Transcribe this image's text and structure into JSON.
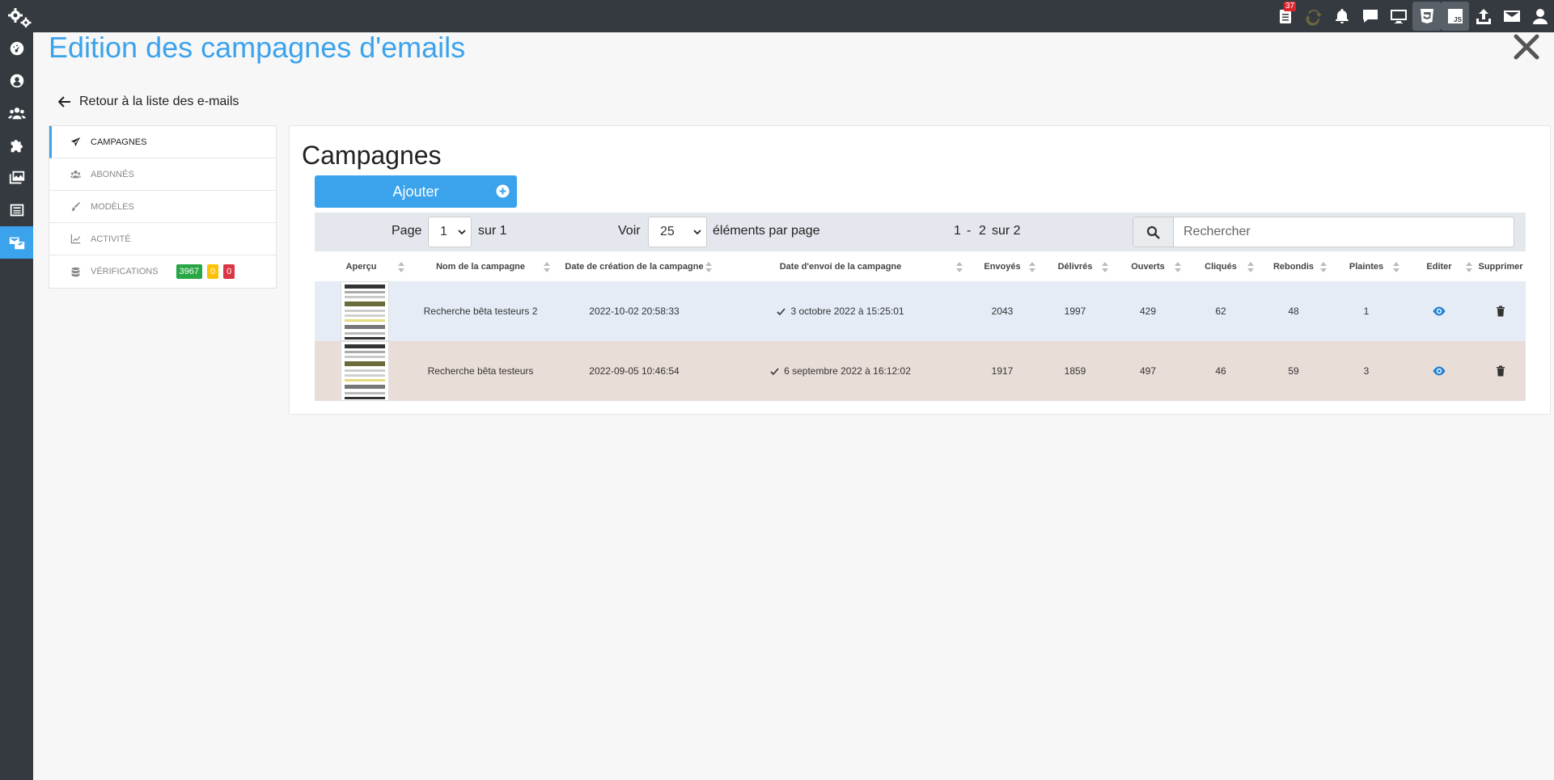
{
  "app": {
    "title": "Edition des campagnes d'emails",
    "back_label": "Retour à la liste des e-mails",
    "notification_count": "37"
  },
  "topbar_icons": [
    "tasks-icon",
    "sync-icon",
    "bell-icon",
    "chat-icon",
    "desktop-icon",
    "css-icon",
    "js-icon",
    "upload-icon",
    "mail-icon",
    "user-icon"
  ],
  "sidebar_icons": [
    "dashboard-icon",
    "user-circle-icon",
    "users-icon",
    "puzzle-icon",
    "images-icon",
    "newspaper-icon",
    "mail-bulk-icon"
  ],
  "menu": {
    "items": [
      {
        "label": "CAMPAGNES",
        "icon": "paper-plane-icon"
      },
      {
        "label": "ABONNÉS",
        "icon": "users-icon"
      },
      {
        "label": "MODÈLES",
        "icon": "brush-icon"
      },
      {
        "label": "ACTIVITÉ",
        "icon": "chart-line-icon"
      },
      {
        "label": "VÉRIFICATIONS",
        "icon": "database-icon"
      }
    ],
    "verif_badges": [
      {
        "value": "3967",
        "color": "#28a745"
      },
      {
        "value": "0",
        "color": "#ffc107"
      },
      {
        "value": "0",
        "color": "#dc3545"
      }
    ]
  },
  "main": {
    "title": "Campagnes",
    "add_label": "Ajouter",
    "page_label": "Page",
    "page_value": "1",
    "page_of": "sur 1",
    "show_label": "Voir",
    "per_page_value": "25",
    "per_page_suffix": "éléments par page",
    "range_start": "1",
    "range_dash": "-",
    "range_end": "2",
    "range_total": "sur 2",
    "search_placeholder": "Rechercher"
  },
  "table": {
    "columns": [
      "Aperçu",
      "Nom de la campagne",
      "Date de création de la campagne",
      "Date d'envoi de la campagne",
      "Envoyés",
      "Délivrés",
      "Ouverts",
      "Cliqués",
      "Rebondis",
      "Plaintes",
      "Editer",
      "Supprimer"
    ],
    "rows": [
      {
        "name": "Recherche bêta testeurs 2",
        "created": "2022-10-02 20:58:33",
        "sent_date": "3 octobre 2022 à 15:25:01",
        "sent": "2043",
        "delivered": "1997",
        "opened": "429",
        "clicked": "62",
        "bounced": "48",
        "complaints": "1",
        "bg": "#e5ecf6"
      },
      {
        "name": "Recherche bêta testeurs",
        "created": "2022-09-05 10:46:54",
        "sent_date": "6 septembre 2022 à 16:12:02",
        "sent": "1917",
        "delivered": "1859",
        "opened": "497",
        "clicked": "46",
        "bounced": "59",
        "complaints": "3",
        "bg": "#e9ddd8"
      }
    ]
  },
  "colors": {
    "accent": "#3ba3ec",
    "topbar": "#343a40"
  }
}
